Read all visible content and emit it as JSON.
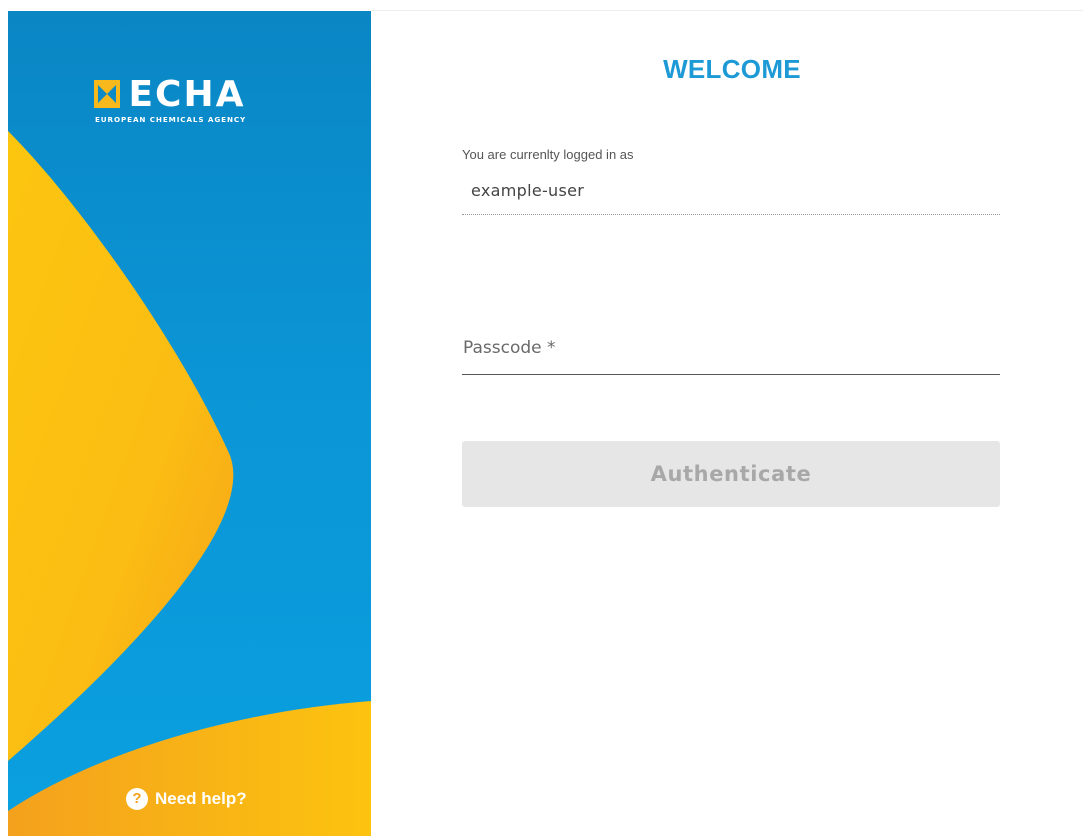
{
  "brand": {
    "name": "ECHA",
    "tagline": "EUROPEAN CHEMICALS AGENCY",
    "logo_icon": "echa-logo-icon",
    "colors": {
      "blue": "#0b95d6",
      "yellow": "#f9b81b"
    }
  },
  "help": {
    "label": "Need help?",
    "icon": "question-circle-icon",
    "icon_glyph": "?"
  },
  "login": {
    "title": "WELCOME",
    "logged_in_label": "You are currenlty logged in as",
    "username": "example-user",
    "passcode_label": "Passcode *",
    "authenticate_label": "Authenticate",
    "authenticate_enabled": false
  },
  "accent_color": "#1d9ad6"
}
